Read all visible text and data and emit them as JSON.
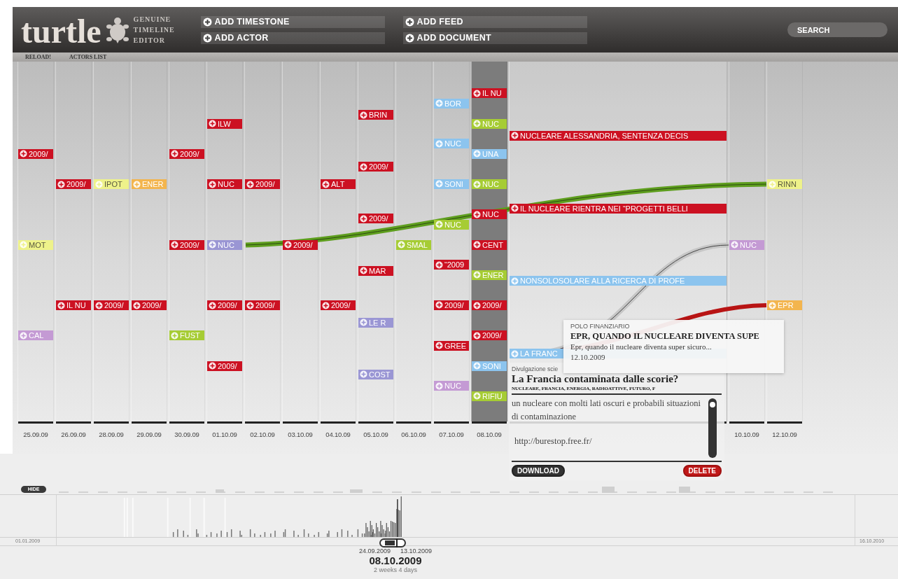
{
  "header": {
    "logo": "turtle",
    "tagline": [
      "GENUINE",
      "TIMELINE",
      "EDITOR"
    ],
    "actions": [
      {
        "label": "ADD TIMESTONE"
      },
      {
        "label": "ADD FEED"
      },
      {
        "label": "ADD ACTOR"
      },
      {
        "label": "ADD DOCUMENT"
      }
    ],
    "search": {
      "placeholder": "SEARCH"
    }
  },
  "toolbar": [
    {
      "label": "RELOAD!"
    },
    {
      "label": "ACTORS LIST"
    }
  ],
  "columns": [
    {
      "date": "25.09.09",
      "selected": false,
      "expanded": false,
      "items": [
        {
          "label": "2009/",
          "color": "#cc1122"
        },
        {
          "label": "MOT",
          "color": "#eef28a"
        },
        {
          "label": "CAL",
          "color": "#c49ad4"
        }
      ]
    },
    {
      "date": "26.09.09",
      "selected": false,
      "expanded": false,
      "items": [
        {
          "label": "2009/",
          "color": "#cc1122"
        },
        {
          "label": "IL NU",
          "color": "#cc1122"
        }
      ]
    },
    {
      "date": "28.09.09",
      "selected": false,
      "expanded": false,
      "items": [
        {
          "label": "IPOT",
          "color": "#eef28a"
        },
        {
          "label": "2009/",
          "color": "#cc1122"
        }
      ]
    },
    {
      "date": "29.09.09",
      "selected": false,
      "expanded": false,
      "items": [
        {
          "label": "ENER",
          "color": "#f3b54e"
        },
        {
          "label": "2009/",
          "color": "#cc1122"
        }
      ]
    },
    {
      "date": "30.09.09",
      "selected": false,
      "expanded": false,
      "items": [
        {
          "label": "2009/",
          "color": "#cc1122"
        },
        {
          "label": "2009/",
          "color": "#cc1122"
        },
        {
          "label": "FUST",
          "color": "#a6cc34"
        }
      ]
    },
    {
      "date": "01.10.09",
      "selected": false,
      "expanded": false,
      "items": [
        {
          "label": "ILW",
          "color": "#cc1122"
        },
        {
          "label": "NUC",
          "color": "#cc1122"
        },
        {
          "label": "NUC",
          "color": "#9a96d4"
        },
        {
          "label": "2009/",
          "color": "#cc1122"
        },
        {
          "label": "2009/",
          "color": "#cc1122"
        }
      ]
    },
    {
      "date": "02.10.09",
      "selected": false,
      "expanded": false,
      "items": [
        {
          "label": "2009/",
          "color": "#cc1122"
        },
        {
          "label": "2009/",
          "color": "#cc1122"
        }
      ]
    },
    {
      "date": "03.10.09",
      "selected": false,
      "expanded": false,
      "items": [
        {
          "label": "2009/",
          "color": "#cc1122"
        }
      ]
    },
    {
      "date": "04.10.09",
      "selected": false,
      "expanded": false,
      "items": [
        {
          "label": "ALT",
          "color": "#cc1122"
        },
        {
          "label": "2009/",
          "color": "#cc1122"
        }
      ]
    },
    {
      "date": "05.10.09",
      "selected": false,
      "expanded": false,
      "items": [
        {
          "label": "BRIN",
          "color": "#cc1122"
        },
        {
          "label": "2009/",
          "color": "#cc1122"
        },
        {
          "label": "2009/",
          "color": "#cc1122"
        },
        {
          "label": "MAR",
          "color": "#cc1122"
        },
        {
          "label": "LE R",
          "color": "#9a96d4"
        },
        {
          "label": "COST",
          "color": "#9a96d4"
        }
      ]
    },
    {
      "date": "06.10.09",
      "selected": false,
      "expanded": false,
      "items": [
        {
          "label": "SMAL",
          "color": "#a6cc34"
        }
      ]
    },
    {
      "date": "07.10.09",
      "selected": false,
      "expanded": false,
      "items": [
        {
          "label": "BOR",
          "color": "#8cc4ee"
        },
        {
          "label": "NUC",
          "color": "#8cc4ee"
        },
        {
          "label": "SONI",
          "color": "#8cc4ee"
        },
        {
          "label": "NUC",
          "color": "#a6cc34"
        },
        {
          "label": "“2009",
          "color": "#cc1122"
        },
        {
          "label": "2009/",
          "color": "#cc1122"
        },
        {
          "label": "GREE",
          "color": "#cc1122"
        },
        {
          "label": "NUC",
          "color": "#c49ad4"
        }
      ]
    },
    {
      "date": "08.10.09",
      "selected": true,
      "expanded": false,
      "items": [
        {
          "label": "IL NU",
          "color": "#cc1122"
        },
        {
          "label": "NUC",
          "color": "#a6cc34"
        },
        {
          "label": "UNA",
          "color": "#8cc4ee"
        },
        {
          "label": "NUC",
          "color": "#a6cc34"
        },
        {
          "label": "NUC",
          "color": "#cc1122"
        },
        {
          "label": "CENT",
          "color": "#cc1122"
        },
        {
          "label": "ENER",
          "color": "#a6cc34"
        },
        {
          "label": "2009/",
          "color": "#cc1122"
        },
        {
          "label": "2009/",
          "color": "#cc1122"
        },
        {
          "label": "SONI",
          "color": "#8cc4ee"
        },
        {
          "label": "RIFIU",
          "color": "#a6cc34"
        }
      ]
    },
    {
      "selected": false,
      "expanded": true,
      "items": [
        {
          "label": "NUCLEARE ALESSANDRIA, SENTENZA DECIS",
          "color": "#cc1122"
        },
        {
          "label": "IL NUCLEARE RIENTRA NEI “PROGETTI BELLI",
          "color": "#cc1122"
        },
        {
          "label": "NONSOLOSOLARE ALLA RICERCA DI PROFE",
          "color": "#8cc4ee"
        },
        {
          "label": "LA FRANC",
          "color": "#8cc4ee"
        }
      ]
    },
    {
      "date": "10.10.09",
      "selected": false,
      "expanded": false,
      "items": [
        {
          "label": "NUC",
          "color": "#c49ad4"
        }
      ]
    },
    {
      "date": "12.10.09",
      "selected": false,
      "expanded": false,
      "items": [
        {
          "label": "RINN",
          "color": "#eef28a"
        },
        {
          "label": "EPR",
          "color": "#f3b54e"
        }
      ]
    }
  ],
  "tooltip": {
    "category": "POLO FINANZIARIO",
    "title": "EPR, QUANDO IL NUCLEARE DIVENTA SUPE",
    "text": "Epr, quando il nucleare diventa super sicuro...",
    "date": "12.10.2009"
  },
  "document": {
    "source": "Divulgazione scie",
    "title": "La Francia contaminata dalle scorie?",
    "tags": "NUCLEARE, FRANCIA, ENERGIA, RADIOATTIVE, FUTURO, F",
    "description": "un nucleare con molti lati oscuri e probabili situazioni di contaminazione",
    "link": "http://burestop.free.fr/",
    "buttons": [
      {
        "label": "DOWNLOAD",
        "kind": "neutral"
      },
      {
        "label": "DELETE",
        "kind": "danger"
      }
    ]
  },
  "timeline": {
    "hide": "HIDE",
    "start": "01.01.2009",
    "end": "16.10.2010",
    "range_start": "24.09.2009",
    "range_end": "13.10.2009",
    "current": "08.10.2009",
    "span": "2 weeks 4 days"
  }
}
